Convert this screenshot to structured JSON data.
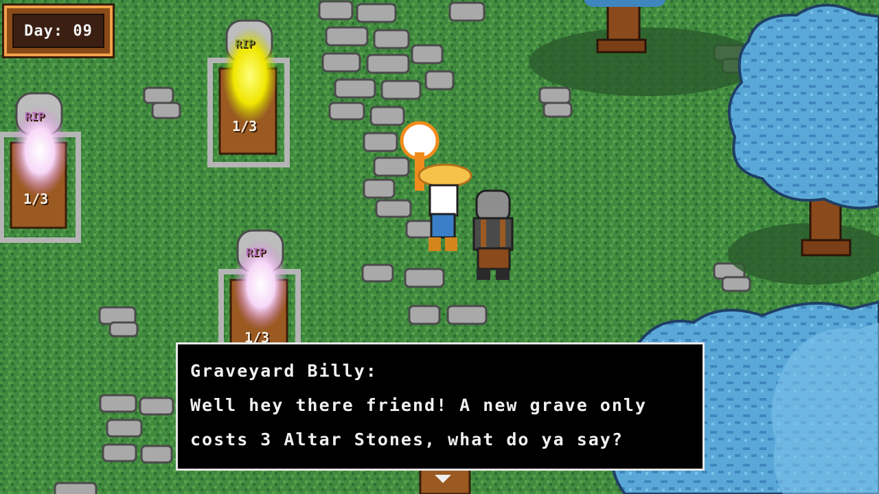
{
  "hud": {
    "day_label": "Day: 09"
  },
  "graves": [
    {
      "tombstone_text": "RIP",
      "progress": "1/3",
      "glow": "pink"
    },
    {
      "tombstone_text": "RIP",
      "progress": "1/3",
      "glow": "yellow"
    },
    {
      "tombstone_text": "RIP",
      "progress": "1/3",
      "glow": "pink"
    }
  ],
  "dialog": {
    "speaker": "Graveyard Billy:",
    "line1": "Well hey there friend! A new grave only",
    "line2": "costs 3 Altar Stones, what do ya say?"
  },
  "colors": {
    "grass": "#3f8a3e",
    "stone": "#a9a9a9",
    "tree_leaves": "#5aa8d8",
    "dirt": "#9b5a22",
    "dialog_bg": "#000000",
    "dialog_text": "#f1f1f1"
  }
}
